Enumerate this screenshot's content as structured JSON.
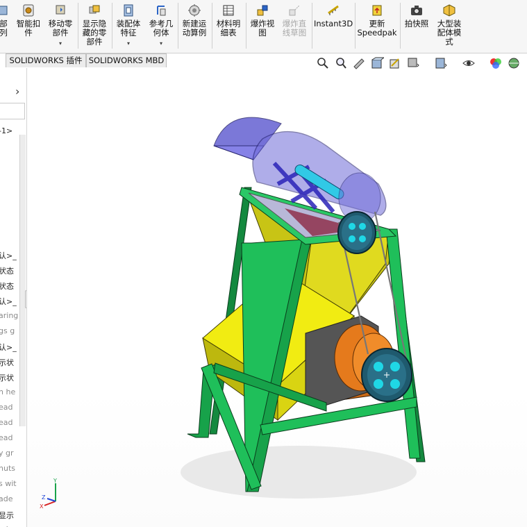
{
  "ribbon": {
    "items": [
      {
        "label": "部\n列",
        "icon": "partial-part-icon"
      },
      {
        "label": "智能扣\n件",
        "icon": "smart-fasteners-icon"
      },
      {
        "label": "移动零\n部件",
        "icon": "move-component-icon",
        "dropdown": "▾"
      },
      {
        "label": "显示隐\n藏的零\n部件",
        "icon": "show-hidden-components-icon"
      },
      {
        "label": "装配体\n特征",
        "icon": "assembly-features-icon",
        "dropdown": "▾"
      },
      {
        "label": "参考几\n何体",
        "icon": "reference-geometry-icon",
        "dropdown": "▾"
      },
      {
        "label": "新建运\n动算例",
        "icon": "new-motion-study-icon"
      },
      {
        "label": "材料明\n细表",
        "icon": "bill-of-materials-icon"
      },
      {
        "label": "爆炸视\n图",
        "icon": "exploded-view-icon"
      },
      {
        "label": "爆炸直\n线草图",
        "icon": "explode-line-sketch-icon",
        "disabled": true
      },
      {
        "label": "Instant3D",
        "icon": "instant3d-icon"
      },
      {
        "label": "更新\nSpeedpak",
        "icon": "update-speedpak-icon"
      },
      {
        "label": "拍快照",
        "icon": "take-snapshot-icon"
      },
      {
        "label": "大型装\n配体模\n式",
        "icon": "large-assembly-mode-icon"
      }
    ]
  },
  "tabs": [
    "SOLIDWORKS 插件",
    "SOLIDWORKS MBD"
  ],
  "tree": {
    "expand_arrow": "›",
    "items": [
      "-1>",
      "认>_",
      "状态",
      "状态",
      "认>_",
      "aring",
      "gs g",
      "认>_",
      "示状",
      "示状",
      "n he",
      "ead",
      "ead",
      "ead",
      "y gr",
      "nuts",
      "s wit",
      "ade",
      "显示",
      "ade"
    ],
    "grey_indices": [
      5,
      6,
      10,
      11,
      12,
      13,
      14,
      15,
      16,
      17,
      19
    ]
  },
  "heads_up_toolbar": [
    "zoom-to-fit-icon",
    "zoom-to-area-icon",
    "previous-view-icon",
    "section-view-icon",
    "view-orientation-icon",
    "display-style-icon",
    "hide-show-items-icon",
    "edit-appearance-icon",
    "apply-scene-icon"
  ],
  "triad": {
    "x_label": "X",
    "y_label": "Y",
    "z_label": "Z"
  },
  "colors": {
    "frame": "#15a04a",
    "hopper": "#d4cf1a",
    "chute": "#f1ec12",
    "drum": "#6f6bd8",
    "motor": "#e57a1c",
    "pulley": "#1f5a6e",
    "pulley_holes": "#1fd7e6"
  }
}
